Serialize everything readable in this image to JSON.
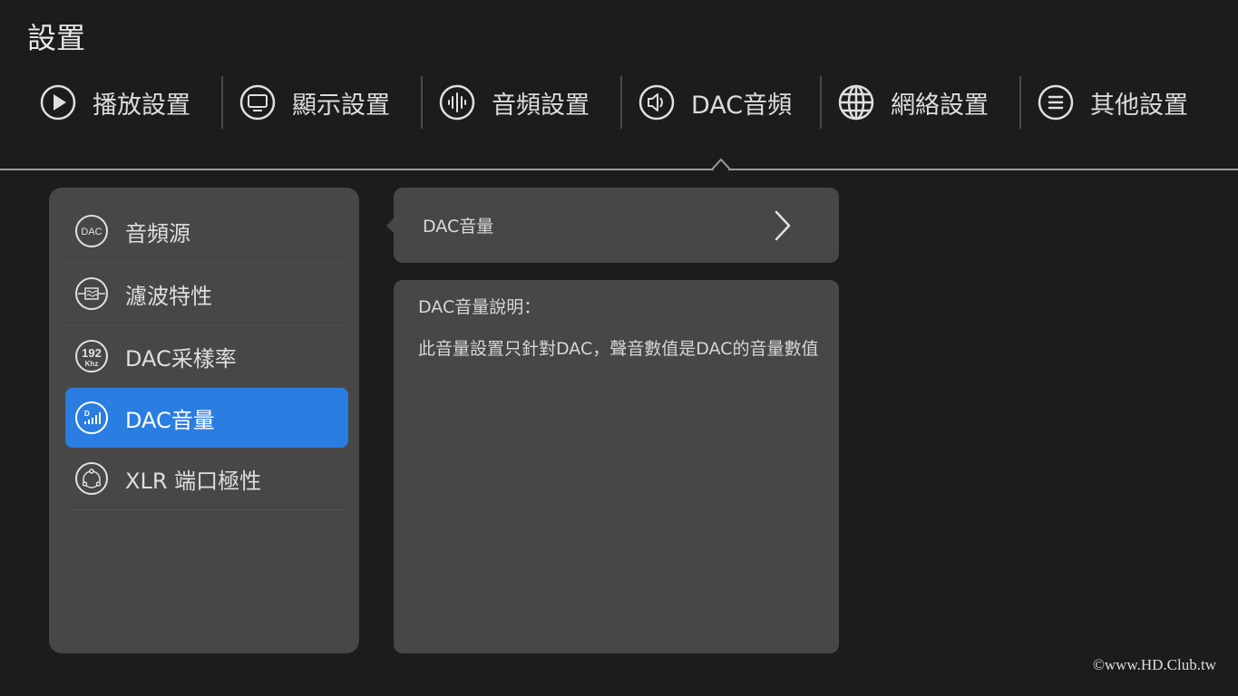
{
  "page_title": "設置",
  "top_nav": [
    {
      "label": "播放設置",
      "icon": "play-icon"
    },
    {
      "label": "顯示設置",
      "icon": "monitor-icon"
    },
    {
      "label": "音頻設置",
      "icon": "audio-wave-icon"
    },
    {
      "label": "DAC音頻",
      "icon": "speaker-icon"
    },
    {
      "label": "網絡設置",
      "icon": "globe-icon"
    },
    {
      "label": "其他設置",
      "icon": "menu-lines-icon"
    }
  ],
  "top_nav_selected": "DAC音頻",
  "side_menu": [
    {
      "label": "音頻源",
      "icon": "dac-badge-icon",
      "icon_text": "DAC"
    },
    {
      "label": "濾波特性",
      "icon": "filter-icon"
    },
    {
      "label": "DAC采樣率",
      "icon": "sample-rate-icon",
      "icon_text": "192",
      "icon_sub": "Khz"
    },
    {
      "label": "DAC音量",
      "icon": "dac-volume-icon",
      "active": true
    },
    {
      "label": "XLR 端口極性",
      "icon": "xlr-port-icon"
    }
  ],
  "option": {
    "label": "DAC音量"
  },
  "description": {
    "title": "DAC音量說明：",
    "text": "此音量設置只針對DAC，聲音數值是DAC的音量數值"
  },
  "watermark": "©www.HD.Club.tw",
  "colors": {
    "background": "#1c1c1c",
    "panel": "#474747",
    "accent": "#2a7de1",
    "text": "#dedede"
  }
}
